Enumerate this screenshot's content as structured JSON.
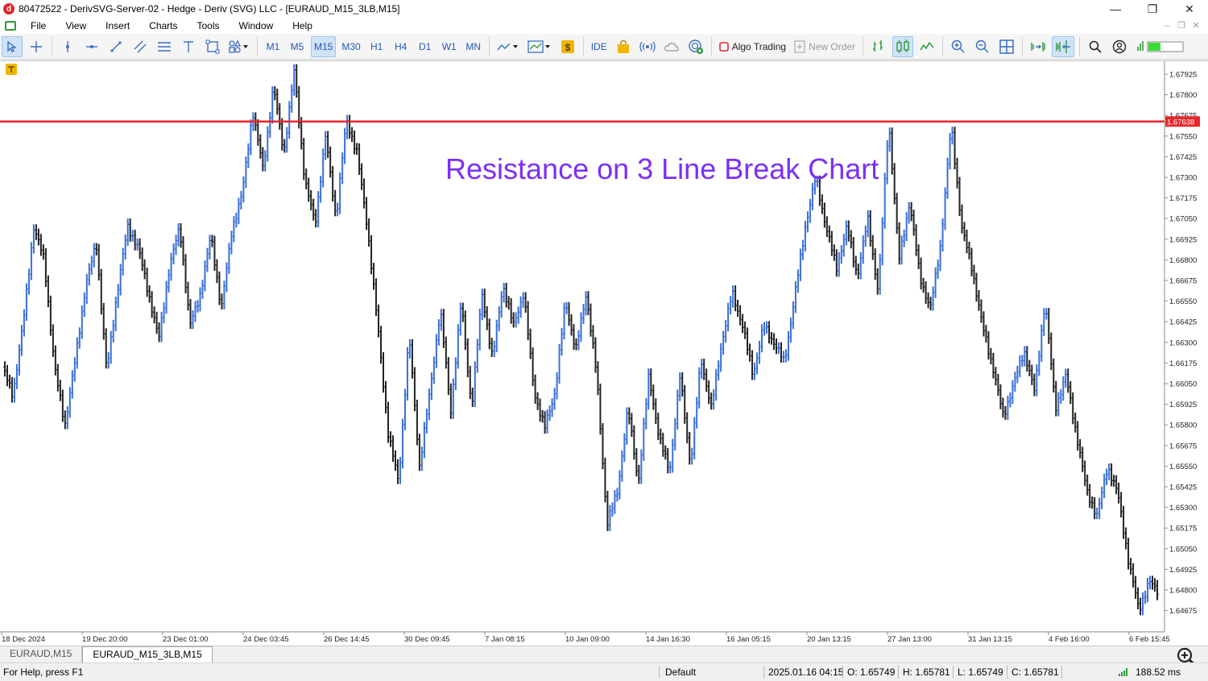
{
  "window": {
    "title": "80472522 - DerivSVG-Server-02 - Hedge - Deriv (SVG) LLC - [EURAUD_M15_3LB,M15]",
    "app_icon_letter": "d",
    "minimize": "—",
    "maximize": "❐",
    "close": "✕"
  },
  "menu": {
    "items": [
      "File",
      "View",
      "Insert",
      "Charts",
      "Tools",
      "Window",
      "Help"
    ]
  },
  "toolbar": {
    "timeframes": [
      "M1",
      "M5",
      "M15",
      "M30",
      "H1",
      "H4",
      "D1",
      "W1",
      "MN"
    ],
    "active_timeframe": "M15",
    "ide_label": "IDE",
    "algo_trading_label": "Algo Trading",
    "new_order_label": "New Order"
  },
  "chart": {
    "annotation": "Resistance on 3 Line Break Chart",
    "annotation_color": "#7b2ff7",
    "resistance_price": "1.67638",
    "resistance_color": "#e8262b",
    "up_color": "#3a6fd8",
    "down_color": "#222222",
    "y_axis_labels": [
      "1.67925",
      "1.67800",
      "1.67675",
      "1.67550",
      "1.67425",
      "1.67300",
      "1.67175",
      "1.67050",
      "1.66925",
      "1.66800",
      "1.66675",
      "1.66550",
      "1.66425",
      "1.66300",
      "1.66175",
      "1.66050",
      "1.65925",
      "1.65800",
      "1.65675",
      "1.65550",
      "1.65425",
      "1.65300",
      "1.65175",
      "1.65050",
      "1.64925",
      "1.64800",
      "1.64675"
    ],
    "x_axis_labels": [
      "18 Dec 2024",
      "19 Dec 20:00",
      "23 Dec 01:00",
      "24 Dec 03:45",
      "26 Dec 14:45",
      "30 Dec 09:45",
      "7 Jan 08:15",
      "10 Jan 09:00",
      "14 Jan 16:30",
      "16 Jan 05:15",
      "20 Jan 13:15",
      "27 Jan 13:00",
      "31 Jan 13:15",
      "4 Feb 16:00",
      "6 Feb 15:45"
    ]
  },
  "chart_data": {
    "type": "bar",
    "title": "Resistance on 3 Line Break Chart",
    "ylim": [
      1.6464,
      1.68
    ],
    "resistance": 1.67638,
    "path_y_pixels_note": "",
    "closes": [
      1.6615,
      1.6598,
      1.6642,
      1.67,
      1.668,
      1.6615,
      1.658,
      1.662,
      1.6665,
      1.669,
      1.6612,
      1.666,
      1.67,
      1.6688,
      1.666,
      1.6632,
      1.6675,
      1.67,
      1.664,
      1.666,
      1.6695,
      1.665,
      1.6698,
      1.672,
      1.677,
      1.6735,
      1.6785,
      1.6745,
      1.6795,
      1.6728,
      1.6702,
      1.6755,
      1.6705,
      1.6765,
      1.6745,
      1.67,
      1.664,
      1.6575,
      1.6545,
      1.6635,
      1.6555,
      1.66,
      1.665,
      1.6588,
      1.6655,
      1.659,
      1.666,
      1.662,
      1.6665,
      1.664,
      1.666,
      1.66,
      1.6578,
      1.66,
      1.6655,
      1.6625,
      1.666,
      1.661,
      1.652,
      1.654,
      1.659,
      1.6545,
      1.661,
      1.6572,
      1.6552,
      1.661,
      1.6555,
      1.662,
      1.659,
      1.663,
      1.666,
      1.664,
      1.661,
      1.664,
      1.663,
      1.6618,
      1.6658,
      1.67,
      1.673,
      1.67,
      1.6675,
      1.67,
      1.667,
      1.6705,
      1.666,
      1.6765,
      1.668,
      1.6715,
      1.667,
      1.665,
      1.669,
      1.6762,
      1.67,
      1.6675,
      1.664,
      1.6615,
      1.6585,
      1.6605,
      1.6625,
      1.66,
      1.6655,
      1.659,
      1.661,
      1.6575,
      1.654,
      1.6525,
      1.6555,
      1.6538,
      1.6498,
      1.6468,
      1.6485,
      1.6478
    ]
  },
  "tabs": [
    "EURAUD,M15",
    "EURAUD_M15_3LB,M15"
  ],
  "active_tab": "EURAUD_M15_3LB,M15",
  "status": {
    "help": "For Help, press F1",
    "profile": "Default",
    "datetime": "2025.01.16 04:15",
    "open": "O: 1.65749",
    "high": "H: 1.65781",
    "low": "L: 1.65749",
    "close": "C: 1.65781",
    "ping": "188.52 ms"
  }
}
